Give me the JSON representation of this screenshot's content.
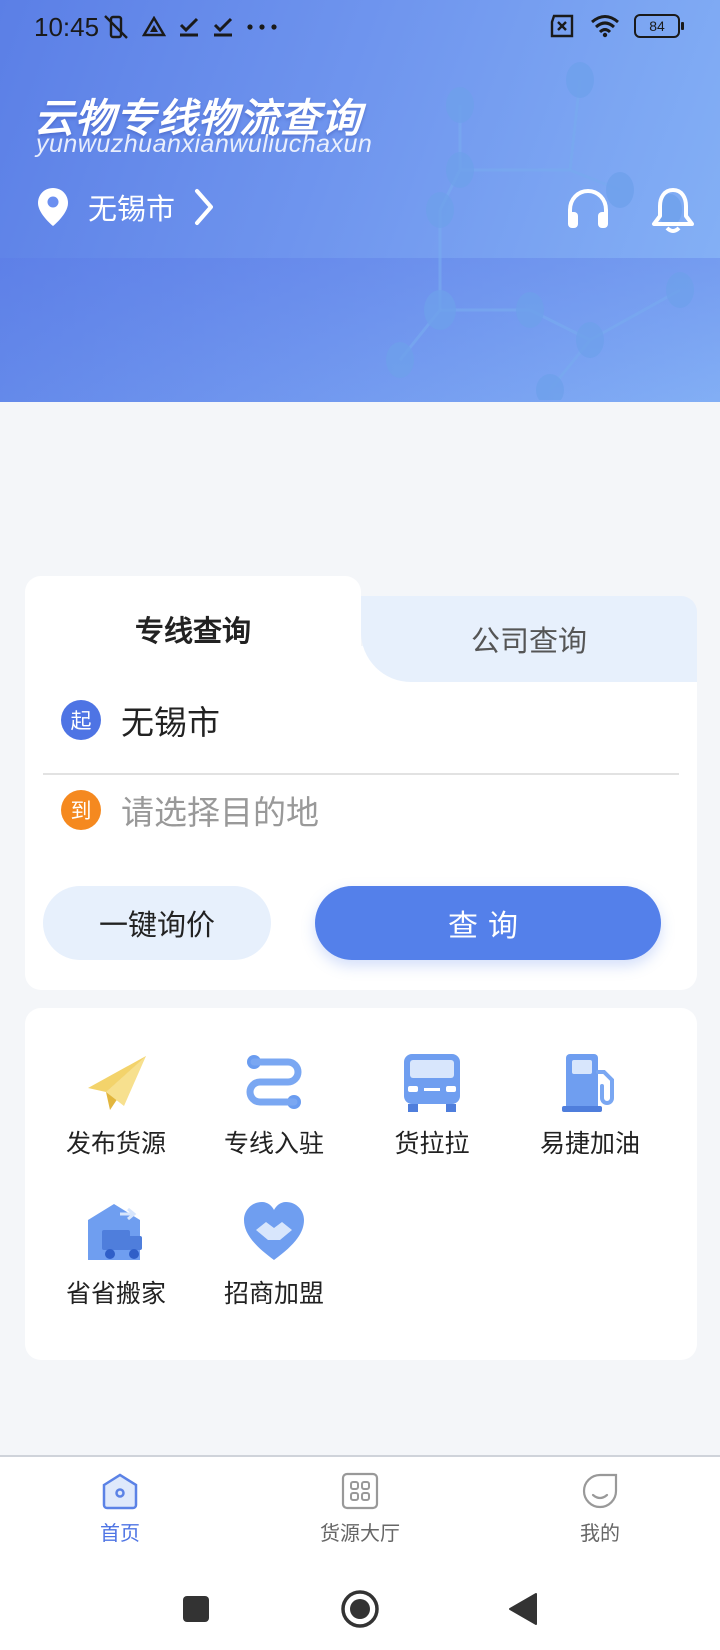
{
  "status_bar": {
    "time": "10:45",
    "battery": "84",
    "icons": [
      "vibrate-off-icon",
      "drive-icon",
      "check-icon",
      "check-icon",
      "more-dots-icon",
      "sim-off-icon",
      "wifi-icon",
      "battery-icon"
    ]
  },
  "header": {
    "title": "云物专线物流查询",
    "subtitle": "yunwuzhuanxianwuliuchaxun",
    "city": "无锡市",
    "actions": [
      "headset-icon",
      "bell-icon"
    ]
  },
  "search": {
    "tabs": [
      {
        "label": "专线查询",
        "active": true
      },
      {
        "label": "公司查询",
        "active": false
      }
    ],
    "start_badge": "起",
    "start_value": "无锡市",
    "end_badge": "到",
    "end_placeholder": "请选择目的地",
    "quote_button": "一键询价",
    "query_button": "查询"
  },
  "services": [
    {
      "label": "发布货源",
      "icon": "paper-plane-icon"
    },
    {
      "label": "专线入驻",
      "icon": "route-icon"
    },
    {
      "label": "货拉拉",
      "icon": "van-icon"
    },
    {
      "label": "易捷加油",
      "icon": "fuel-pump-icon"
    },
    {
      "label": "省省搬家",
      "icon": "moving-truck-icon"
    },
    {
      "label": "招商加盟",
      "icon": "handshake-heart-icon"
    }
  ],
  "tabbar": [
    {
      "label": "首页",
      "icon": "home-icon",
      "active": true
    },
    {
      "label": "货源大厅",
      "icon": "grid-icon",
      "active": false
    },
    {
      "label": "我的",
      "icon": "profile-icon",
      "active": false
    }
  ],
  "colors": {
    "accent": "#5480EA",
    "start_dot": "#4E74E4",
    "end_dot": "#F5891F",
    "tab_inactive_bg": "#E7F0FC",
    "page_bg": "#F4F6F9"
  }
}
